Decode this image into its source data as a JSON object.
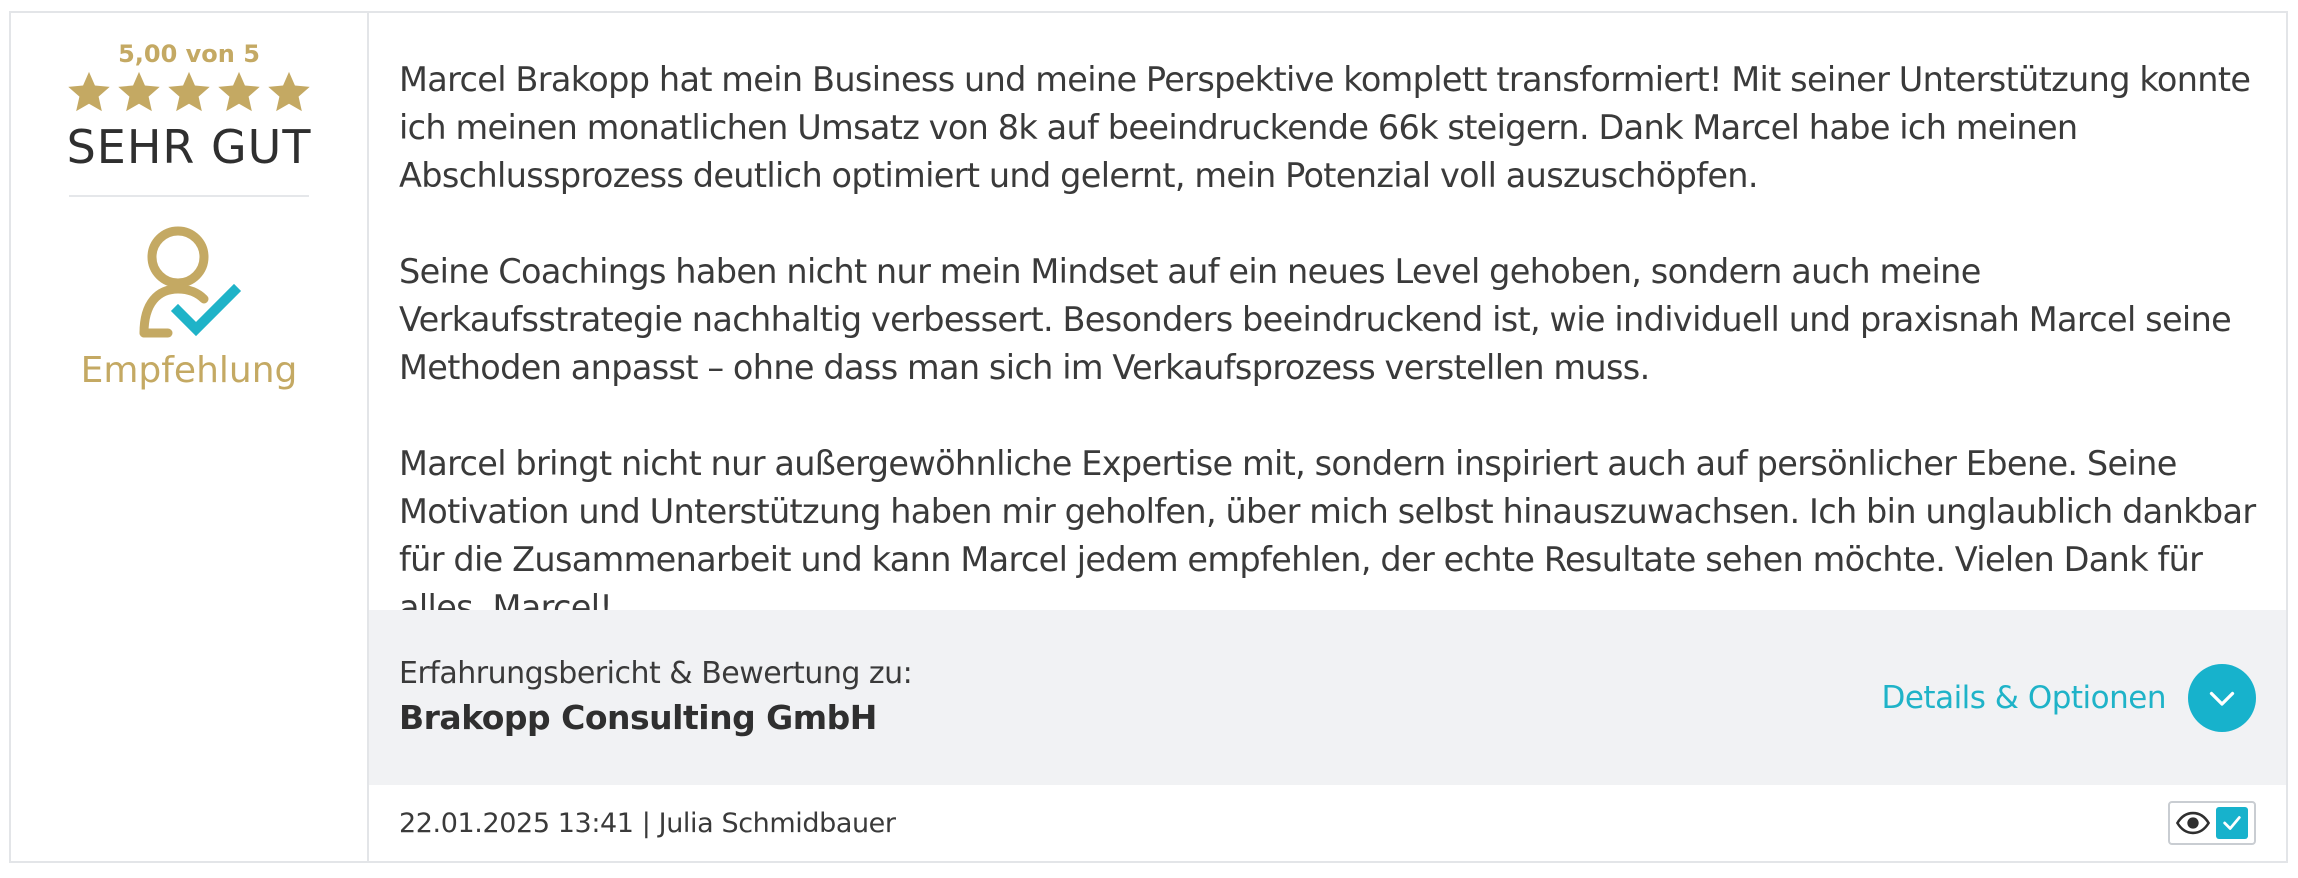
{
  "rating": {
    "score_text": "5,00 von 5",
    "stars": 5,
    "grade": "SEHR GUT",
    "recommendation_label": "Empfehlung"
  },
  "review": {
    "paragraphs": [
      "Marcel Brakopp hat mein Business und meine Perspektive komplett transformiert! Mit seiner Unterstützung konnte ich meinen monatlichen Umsatz von 8k auf beeindruckende 66k steigern. Dank Marcel habe ich meinen Abschlussprozess deutlich optimiert und gelernt, mein Potenzial voll auszuschöpfen.",
      "Seine Coachings haben nicht nur mein Mindset auf ein neues Level gehoben, sondern auch meine Verkaufsstrategie nachhaltig verbessert. Besonders beeindruckend ist, wie individuell und praxisnah Marcel seine Methoden anpasst – ohne dass man sich im Verkaufsprozess verstellen muss.",
      "Marcel bringt nicht nur außergewöhnliche Expertise mit, sondern inspiriert auch auf persönlicher Ebene. Seine Motivation und Unterstützung haben mir geholfen, über mich selbst hinauszuwachsen. Ich bin unglaublich dankbar für die Zusammenarbeit und kann Marcel jedem empfehlen, der echte Resultate sehen möchte. Vielen Dank für alles, Marcel!"
    ]
  },
  "subject": {
    "caption": "Erfahrungsbericht & Bewertung zu:",
    "name": "Brakopp Consulting GmbH",
    "details_label": "Details & Optionen"
  },
  "footer": {
    "meta": "22.01.2025 13:41 | Julia Schmidbauer"
  },
  "colors": {
    "gold": "#c4a963",
    "accent": "#17b2cc"
  },
  "icons": {
    "star": "star-icon",
    "recommend": "user-check-icon",
    "expand": "chevron-down-icon",
    "visibility": "eye-icon",
    "verified": "checkmark-icon"
  }
}
